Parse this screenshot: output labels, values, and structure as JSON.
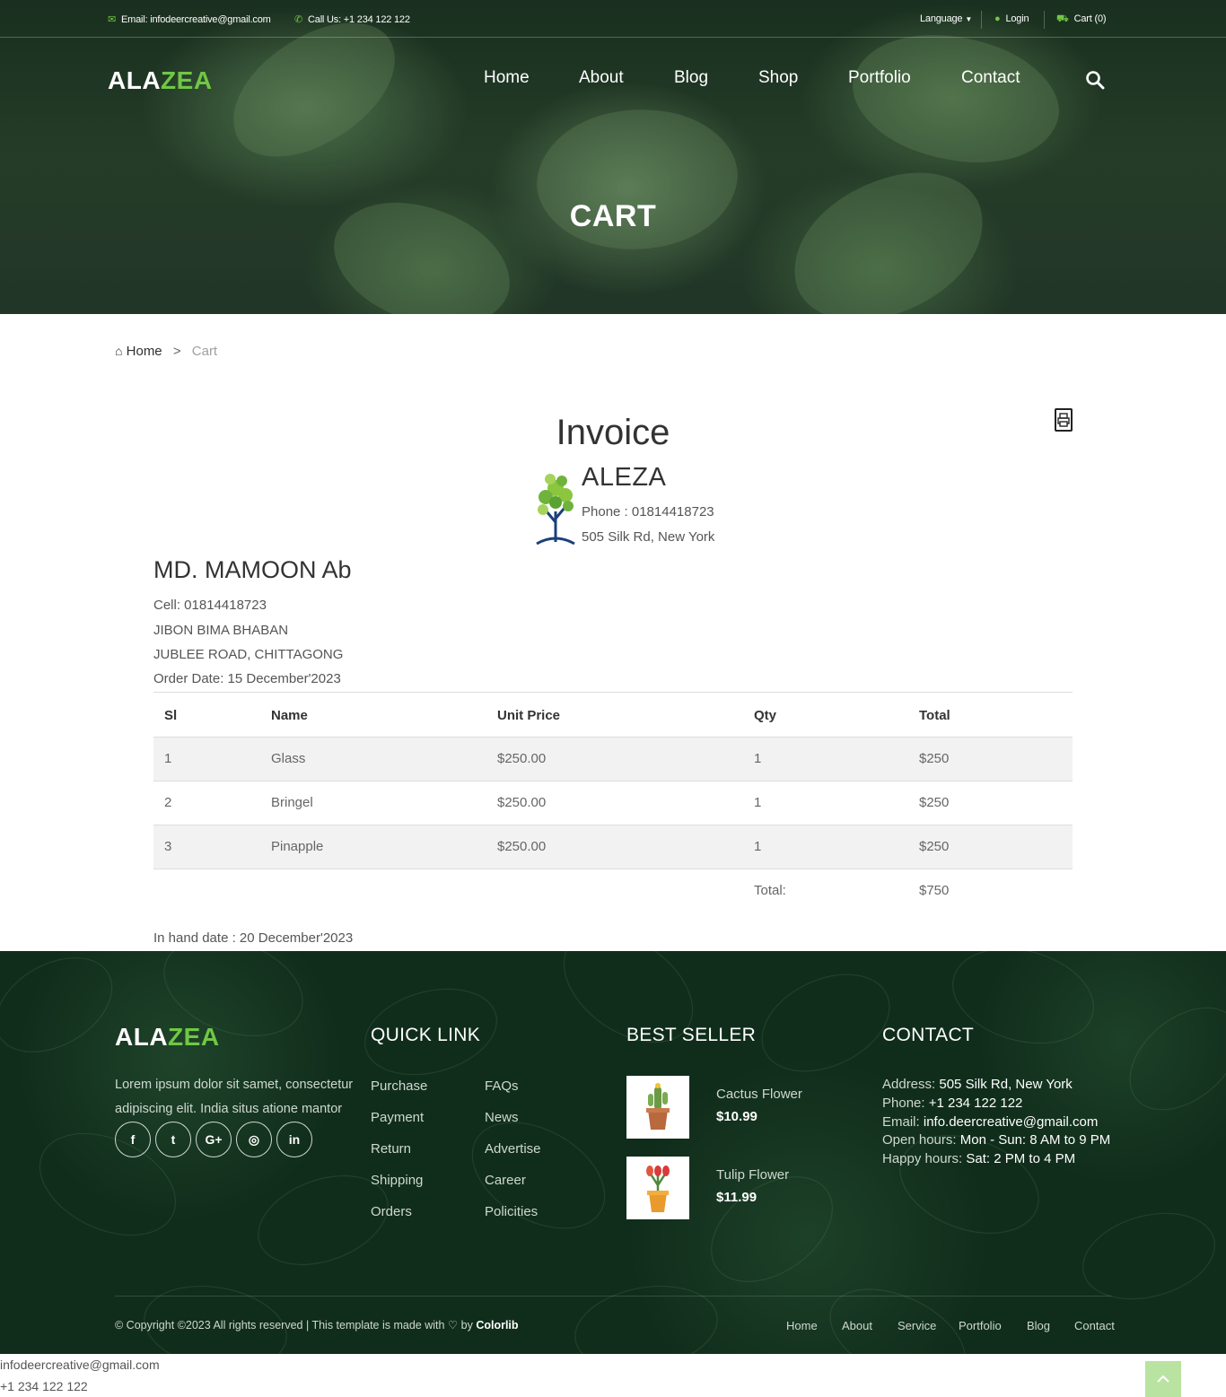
{
  "topbar": {
    "email": "Email: infodeercreative@gmail.com",
    "phone": "Call Us: +1 234 122 122",
    "language": "Language",
    "login": "Login",
    "cart": "Cart (0)"
  },
  "brand": {
    "part1": "ALA",
    "part2": "ZEA"
  },
  "nav": [
    "Home",
    "About",
    "Blog",
    "Shop",
    "Portfolio",
    "Contact"
  ],
  "hero": {
    "title": "CART"
  },
  "breadcrumb": {
    "home": "Home",
    "separator": ">",
    "current": "Cart"
  },
  "invoice": {
    "title": "Invoice",
    "company": {
      "name": "ALEZA",
      "phone": "Phone : 01814418723",
      "address": "505 Silk Rd, New York"
    },
    "customer": {
      "name": "MD. MAMOON Ab",
      "cell": "Cell: 01814418723",
      "address1": "JIBON BIMA BHABAN",
      "address2": "JUBLEE ROAD, CHITTAGONG",
      "order_date": "Order Date: 15 December'2023"
    },
    "columns": [
      "Sl",
      "Name",
      "Unit Price",
      "Qty",
      "Total"
    ],
    "rows": [
      [
        "1",
        "Glass",
        "$250.00",
        "1",
        "$250"
      ],
      [
        "2",
        "Bringel",
        "$250.00",
        "1",
        "$250"
      ],
      [
        "3",
        "Pinapple",
        "$250.00",
        "1",
        "$250"
      ]
    ],
    "total_label": "Total:",
    "total_value": "$750",
    "in_hand": "In hand date : 20 December'2023"
  },
  "footer": {
    "about_line1": "Lorem ipsum dolor sit samet, consectetur",
    "about_line2": "adipiscing elit. India situs atione mantor",
    "social_icons": [
      "facebook-icon",
      "twitter-icon",
      "google-plus-icon",
      "instagram-icon",
      "linkedin-icon"
    ],
    "social_glyphs": [
      "f",
      "t",
      "G+",
      "◎",
      "in"
    ],
    "quick_link_title": "QUICK LINK",
    "quick_links_col1": [
      "Purchase",
      "Payment",
      "Return",
      "Shipping",
      "Orders"
    ],
    "quick_links_col2": [
      "FAQs",
      "News",
      "Advertise",
      "Career",
      "Policities"
    ],
    "best_seller_title": "BEST SELLER",
    "products": [
      {
        "name": "Cactus Flower",
        "price": "$10.99"
      },
      {
        "name": "Tulip Flower",
        "price": "$11.99"
      }
    ],
    "contact_title": "CONTACT",
    "contact": [
      {
        "label": "Address:",
        "value": "505 Silk Rd, New York"
      },
      {
        "label": "Phone:",
        "value": "+1 234 122 122"
      },
      {
        "label": "Email:",
        "value": "info.deercreative@gmail.com"
      },
      {
        "label": "Open hours:",
        "value": "Mon - Sun: 8 AM to 9 PM"
      },
      {
        "label": "Happy hours:",
        "value": "Sat: 2 PM to 4 PM"
      }
    ],
    "copyright_text": "© Copyright ©2023 All rights reserved | This template is made with",
    "copyright_by": "by",
    "copyright_brand": "Colorlib",
    "bottom_nav": [
      "Home",
      "About",
      "Service",
      "Portfolio",
      "Blog",
      "Contact"
    ]
  },
  "below": {
    "email": "infodeercreative@gmail.com",
    "phone": "+1 234 122 122"
  },
  "colors": {
    "accent": "#70c745",
    "footer_bg": "#102d1b",
    "scroll_top": "#b8e3a1"
  }
}
